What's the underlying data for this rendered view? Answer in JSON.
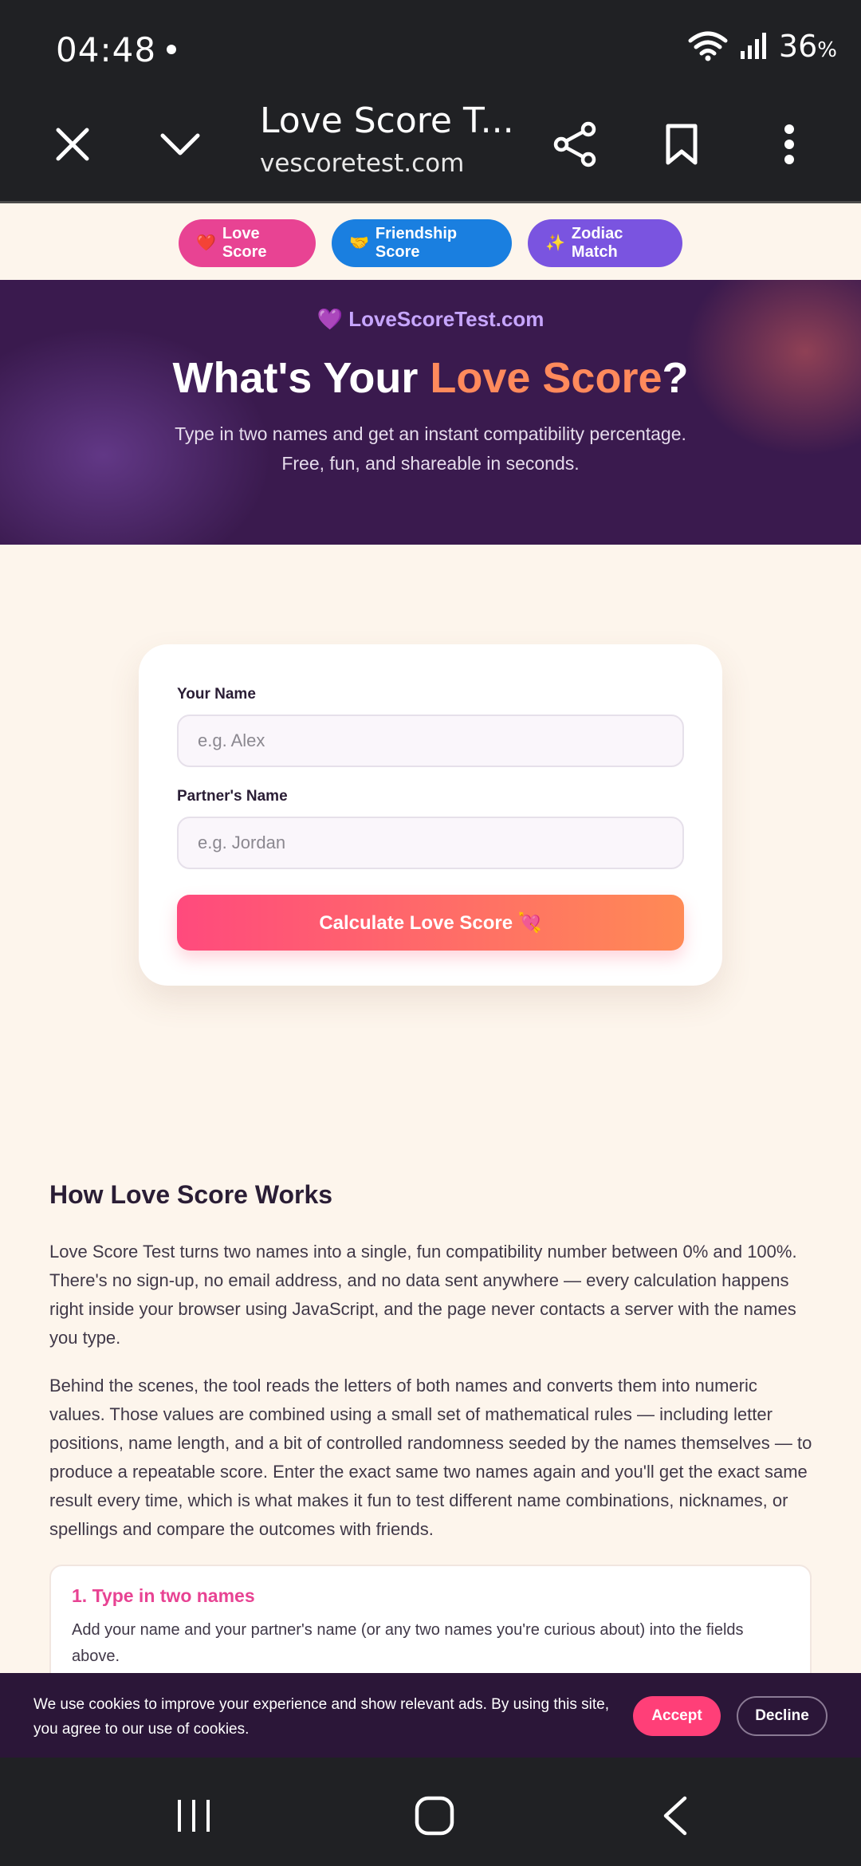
{
  "status": {
    "time": "04:48",
    "battery": "36",
    "battery_unit": "%"
  },
  "browser": {
    "title": "Love Score T...",
    "url": "vescoretest.com"
  },
  "tabs": [
    {
      "emoji": "❤️",
      "label": "Love Score"
    },
    {
      "emoji": "🤝",
      "label": "Friendship Score"
    },
    {
      "emoji": "✨",
      "label": "Zodiac Match"
    }
  ],
  "hero": {
    "brand": "💜 LoveScoreTest.com",
    "title_prefix": "What's Your ",
    "title_accent": "Love Score",
    "title_suffix": "?",
    "subtitle_line1": "Type in two names and get an instant compatibility percentage.",
    "subtitle_line2": "Free, fun, and shareable in seconds."
  },
  "form": {
    "your_name_label": "Your Name",
    "your_name_placeholder": "e.g. Alex",
    "partner_label": "Partner's Name",
    "partner_placeholder": "e.g. Jordan",
    "submit_label": "Calculate Love Score 💘"
  },
  "how": {
    "title": "How Love Score Works",
    "para1": "Love Score Test turns two names into a single, fun compatibility number between 0% and 100%. There's no sign-up, no email address, and no data sent anywhere — every calculation happens right inside your browser using JavaScript, and the page never contacts a server with the names you type.",
    "para2": "Behind the scenes, the tool reads the letters of both names and converts them into numeric values. Those values are combined using a small set of mathematical rules — including letter positions, name length, and a bit of controlled randomness seeded by the names themselves — to produce a repeatable score. Enter the exact same two names again and you'll get the exact same result every time, which is what makes it fun to test different name combinations, nicknames, or spellings and compare the outcomes with friends.",
    "step1_title": "1. Type in two names",
    "step1_text": "Add your name and your partner's name (or any two names you're curious about) into the fields above."
  },
  "cookie": {
    "text": "We use cookies to improve your experience and show relevant ads. By using this site, you agree to our use of cookies.",
    "accept": "Accept",
    "decline": "Decline"
  },
  "colors": {
    "accent_pink": "#e84393",
    "accent_orange": "#ff8a5c",
    "hero_bg": "#3a1a4e",
    "page_bg": "#fdf5ec"
  }
}
